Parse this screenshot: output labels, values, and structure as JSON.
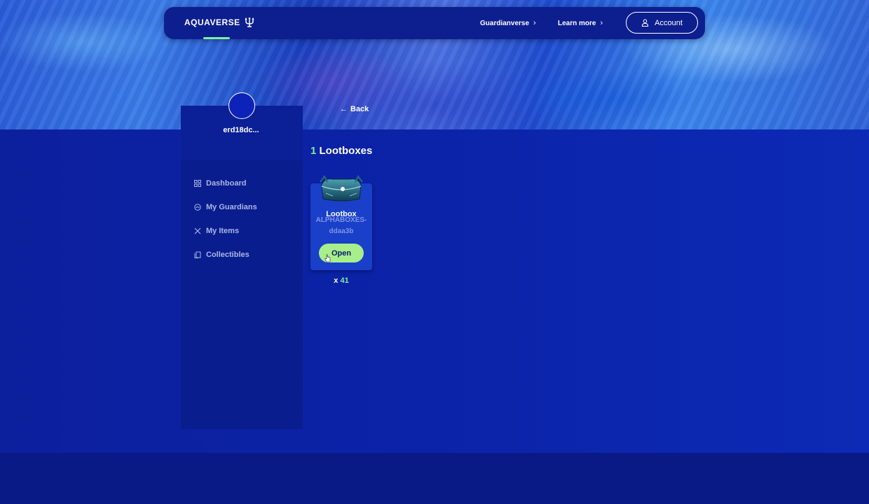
{
  "header": {
    "logo_text": "AQUAVERSE",
    "logo_icon": "trident-icon",
    "nav": [
      {
        "label": "Guardianverse",
        "icon": "chevron-right-icon"
      },
      {
        "label": "Learn more",
        "icon": "chevron-right-icon"
      }
    ],
    "account_label": "Account",
    "account_icon": "user-icon"
  },
  "profile": {
    "username": "erd18dc..."
  },
  "sidebar": {
    "items": [
      {
        "label": "Dashboard",
        "icon": "grid-icon"
      },
      {
        "label": "My Guardians",
        "icon": "guardian-icon"
      },
      {
        "label": "My Items",
        "icon": "crossed-swords-icon"
      },
      {
        "label": "Collectibles",
        "icon": "cards-icon"
      }
    ]
  },
  "main": {
    "back_label": "Back",
    "title_count": "1",
    "title_text": "Lootboxes",
    "lootboxes": [
      {
        "name": "Lootbox",
        "code": "ALPHABOXES-ddaa3b",
        "open_label": "Open",
        "qty_prefix": "x",
        "qty": "41"
      }
    ]
  },
  "colors": {
    "accent_green": "#7cf0a0",
    "button_green": "#a8ee8a",
    "nav_bg": "#0d1f8f",
    "page_bg": "#0a1f9a",
    "muted_text": "#a9b6e6"
  }
}
